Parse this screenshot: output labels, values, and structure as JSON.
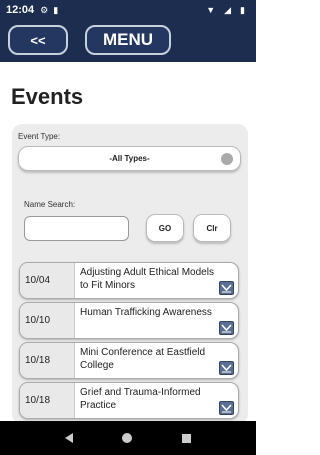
{
  "status_bar": {
    "time": "12:04",
    "left_icons": [
      "gear-icon",
      "sim-card-icon"
    ],
    "right_icons": [
      "wifi-icon",
      "signal-icon",
      "battery-icon"
    ]
  },
  "nav": {
    "back_label": "<<",
    "menu_label": "MENU"
  },
  "page_title": "Events",
  "filters": {
    "event_type_label": "Event Type:",
    "event_type_value": "-All Types-",
    "name_search_label": "Name Search:",
    "name_search_value": "",
    "go_label": "GO",
    "clear_label": "Clr"
  },
  "events": [
    {
      "date": "10/04",
      "name": "Adjusting Adult Ethical Models to Fit Minors"
    },
    {
      "date": "10/10",
      "name": "Human Trafficking Awareness"
    },
    {
      "date": "10/18",
      "name": "Mini Conference at Eastfield College"
    },
    {
      "date": "10/18",
      "name": "Grief and Trauma-Informed Practice"
    }
  ],
  "colors": {
    "header_bg": "#1d2d4f",
    "panel_bg": "#ececec",
    "expand_icon": "#5a6f94"
  }
}
